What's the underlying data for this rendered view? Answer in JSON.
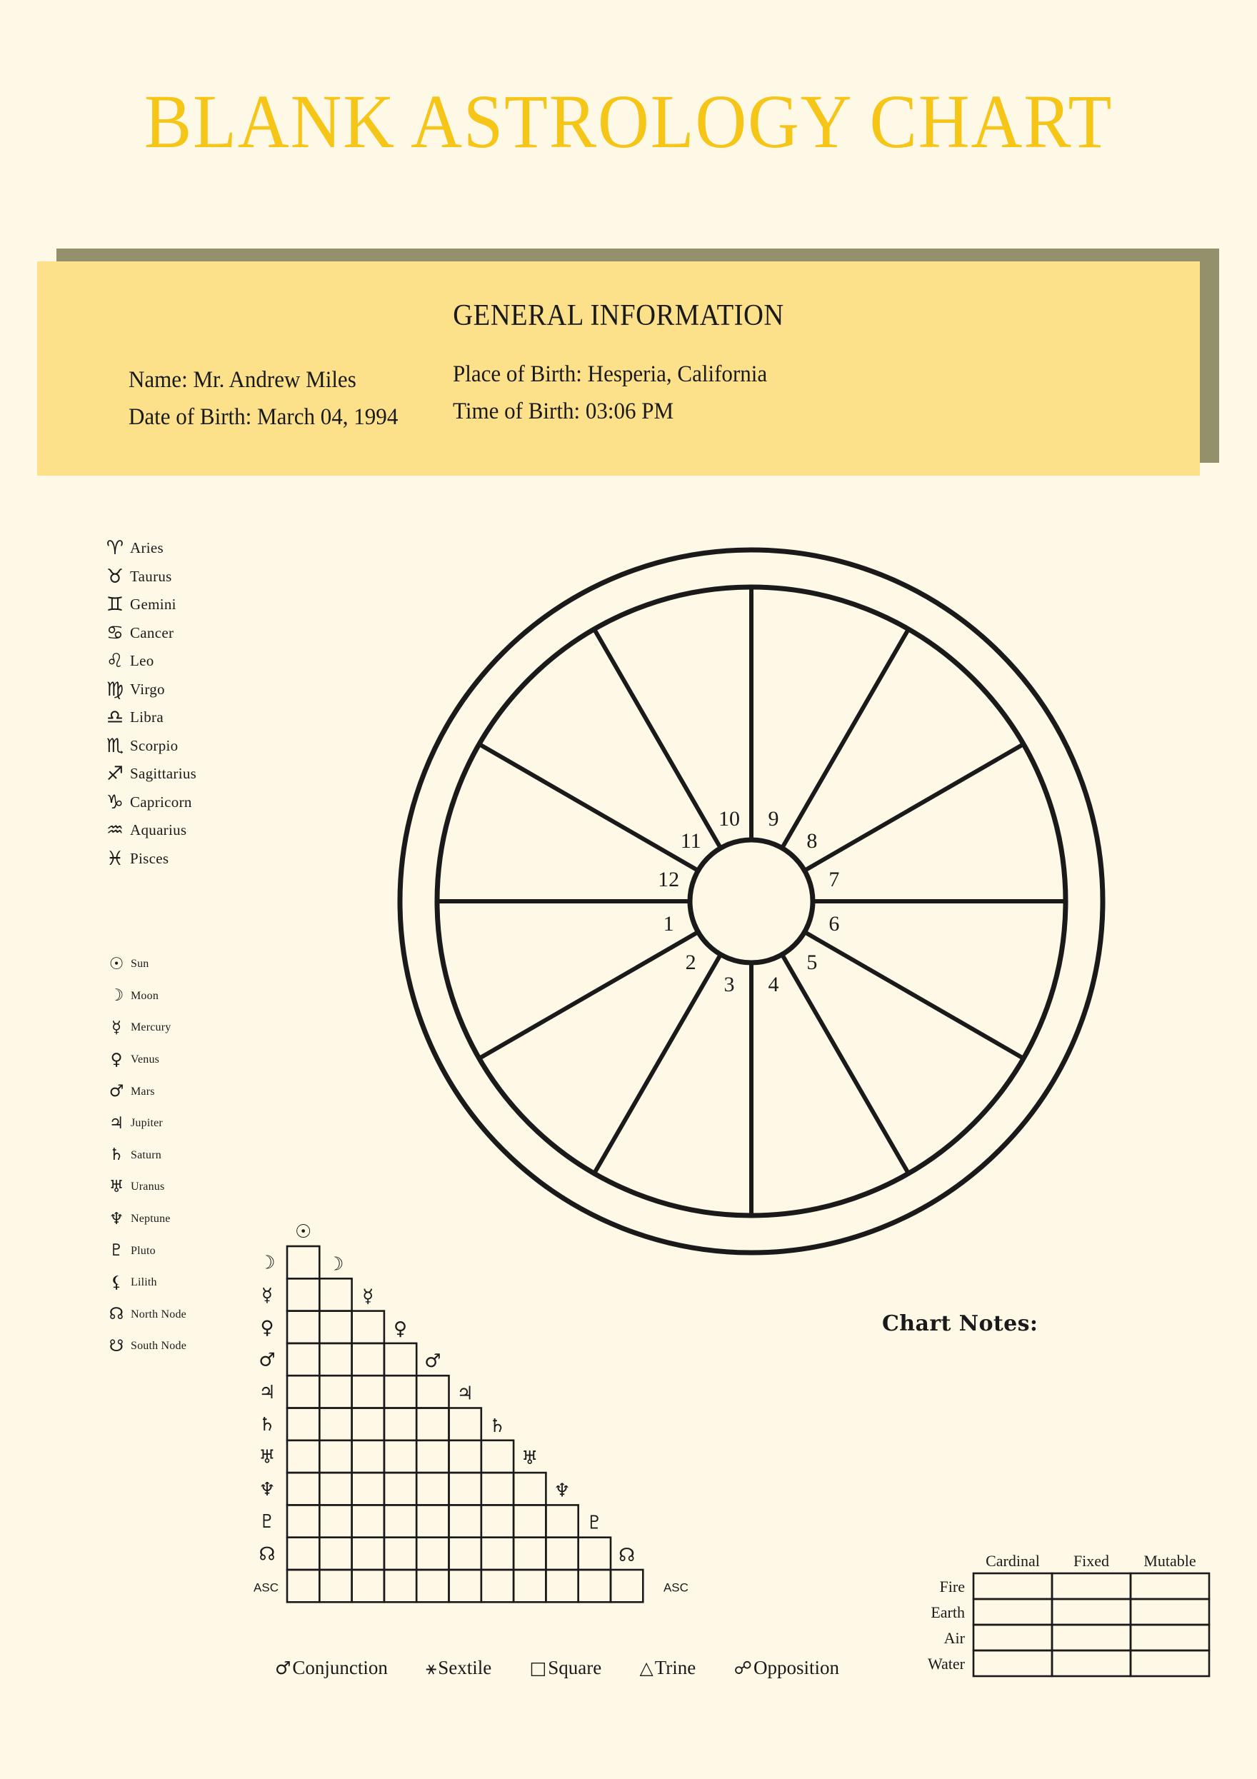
{
  "page": {
    "title": "BLANK ASTROLOGY CHART",
    "background_color": "#FEF8E7",
    "title_color": "#F5C518"
  },
  "info_card": {
    "heading": "GENERAL INFORMATION",
    "card_color": "#FCE18A",
    "shadow_color": "#93906B",
    "fields": {
      "name": "Name: Mr. Andrew Miles",
      "date_of_birth": "Date of Birth: March 04, 1994",
      "place_of_birth": "Place of Birth: Hesperia, California",
      "time_of_birth": "Time of Birth: 03:06 PM"
    }
  },
  "signs": [
    {
      "glyph": "♈",
      "name": "Aries"
    },
    {
      "glyph": "♉",
      "name": "Taurus"
    },
    {
      "glyph": "♊",
      "name": "Gemini"
    },
    {
      "glyph": "♋",
      "name": "Cancer"
    },
    {
      "glyph": "♌",
      "name": "Leo"
    },
    {
      "glyph": "♍",
      "name": "Virgo"
    },
    {
      "glyph": "♎",
      "name": "Libra"
    },
    {
      "glyph": "♏",
      "name": "Scorpio"
    },
    {
      "glyph": "♐",
      "name": "Sagittarius"
    },
    {
      "glyph": "♑",
      "name": "Capricorn"
    },
    {
      "glyph": "♒",
      "name": "Aquarius"
    },
    {
      "glyph": "♓",
      "name": "Pisces"
    }
  ],
  "planets": [
    {
      "glyph": "☉",
      "name": "Sun"
    },
    {
      "glyph": "☽",
      "name": "Moon"
    },
    {
      "glyph": "☿",
      "name": "Mercury"
    },
    {
      "glyph": "♀",
      "name": "Venus"
    },
    {
      "glyph": "♂",
      "name": "Mars"
    },
    {
      "glyph": "♃",
      "name": "Jupiter"
    },
    {
      "glyph": "♄",
      "name": "Saturn"
    },
    {
      "glyph": "♅",
      "name": "Uranus"
    },
    {
      "glyph": "♆",
      "name": "Neptune"
    },
    {
      "glyph": "♇",
      "name": "Pluto"
    },
    {
      "glyph": "⚸",
      "name": "Lilith"
    },
    {
      "glyph": "☊",
      "name": "North Node"
    },
    {
      "glyph": "☋",
      "name": "South Node"
    }
  ],
  "wheel": {
    "house_numbers": [
      "1",
      "2",
      "3",
      "4",
      "5",
      "6",
      "7",
      "8",
      "9",
      "10",
      "11",
      "12"
    ]
  },
  "aspect_grid": {
    "column_glyphs": [
      "☉",
      "☽",
      "☿",
      "♀",
      "♂",
      "♃",
      "♄",
      "♅",
      "♆",
      "♇",
      "☊",
      "ASC"
    ],
    "row_glyphs": [
      "☽",
      "☿",
      "♀",
      "♂",
      "♃",
      "♄",
      "♅",
      "♆",
      "♇",
      "☊",
      "ASC"
    ],
    "asc_label": "ASC"
  },
  "aspect_legend": [
    {
      "glyph": "♂",
      "label": "Conjunction"
    },
    {
      "glyph": "⚹",
      "label": "Sextile"
    },
    {
      "glyph": "□",
      "label": "Square"
    },
    {
      "glyph": "△",
      "label": "Trine"
    },
    {
      "glyph": "☍",
      "label": "Opposition"
    }
  ],
  "chart_notes": {
    "label": "Chart Notes:"
  },
  "element_table": {
    "columns": [
      "Cardinal",
      "Fixed",
      "Mutable"
    ],
    "rows": [
      "Fire",
      "Earth",
      "Air",
      "Water"
    ]
  }
}
